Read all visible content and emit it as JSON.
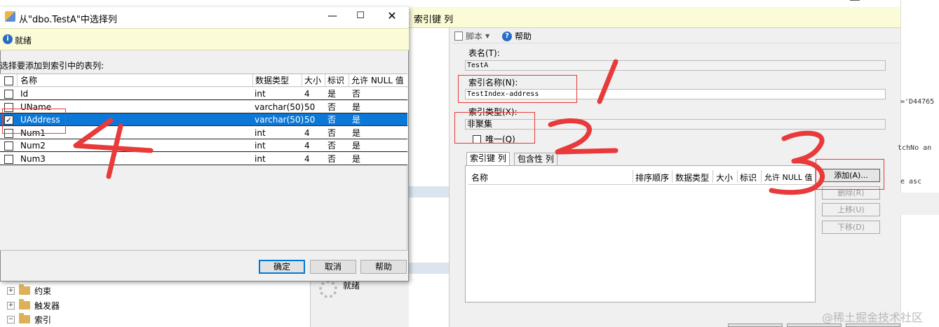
{
  "explorer": {
    "tree_items": [
      {
        "label": "约束",
        "toggle": "+"
      },
      {
        "label": "触发器",
        "toggle": "+"
      },
      {
        "label": "索引",
        "toggle": "−"
      }
    ]
  },
  "index_window": {
    "header_tabs": "索引键  列",
    "toolbar": {
      "script_label": "脚本",
      "help_label": "帮助"
    },
    "table_name_label": "表名(T):",
    "table_name_value": "TestA",
    "index_name_label": "索引名称(N):",
    "index_name_value": "TestIndex-address",
    "index_type_label": "索引类型(X):",
    "index_type_value": "非聚集",
    "unique_label": "唯一(Q)",
    "tabs": [
      "索引键 列",
      "包含性 列"
    ],
    "grid_columns": [
      "名称",
      "排序顺序",
      "数据类型",
      "大小",
      "标识",
      "允许 NULL 值"
    ],
    "side_buttons": [
      "添加(A)...",
      "删除(R)",
      "上移(U)",
      "下移(D)"
    ],
    "status": "就绪"
  },
  "code_fragments": [
    "='D44765",
    "tchNo an",
    "e asc"
  ],
  "dialog": {
    "title": "从\"dbo.TestA\"中选择列",
    "info": "就绪",
    "prompt": "选择要添加到索引中的表列:",
    "columns": [
      "名称",
      "数据类型",
      "大小",
      "标识",
      "允许 NULL 值"
    ],
    "rows": [
      {
        "name": "Id",
        "type": "int",
        "size": "4",
        "identity": "是",
        "nullable": "否",
        "checked": false
      },
      {
        "name": "UName",
        "type": "varchar(50)",
        "size": "50",
        "identity": "否",
        "nullable": "是",
        "checked": false
      },
      {
        "name": "UAddress",
        "type": "varchar(50)",
        "size": "50",
        "identity": "否",
        "nullable": "是",
        "checked": true
      },
      {
        "name": "Num1",
        "type": "int",
        "size": "4",
        "identity": "否",
        "nullable": "是",
        "checked": false
      },
      {
        "name": "Num2",
        "type": "int",
        "size": "4",
        "identity": "否",
        "nullable": "是",
        "checked": false
      },
      {
        "name": "Num3",
        "type": "int",
        "size": "4",
        "identity": "否",
        "nullable": "是",
        "checked": false
      }
    ],
    "buttons": {
      "ok": "确定",
      "cancel": "取消",
      "help": "帮助"
    }
  },
  "annotations": {
    "numbers": [
      "1",
      "2",
      "3",
      "4"
    ],
    "color": "#e83a3a"
  },
  "watermark": "@稀土掘金技术社区"
}
